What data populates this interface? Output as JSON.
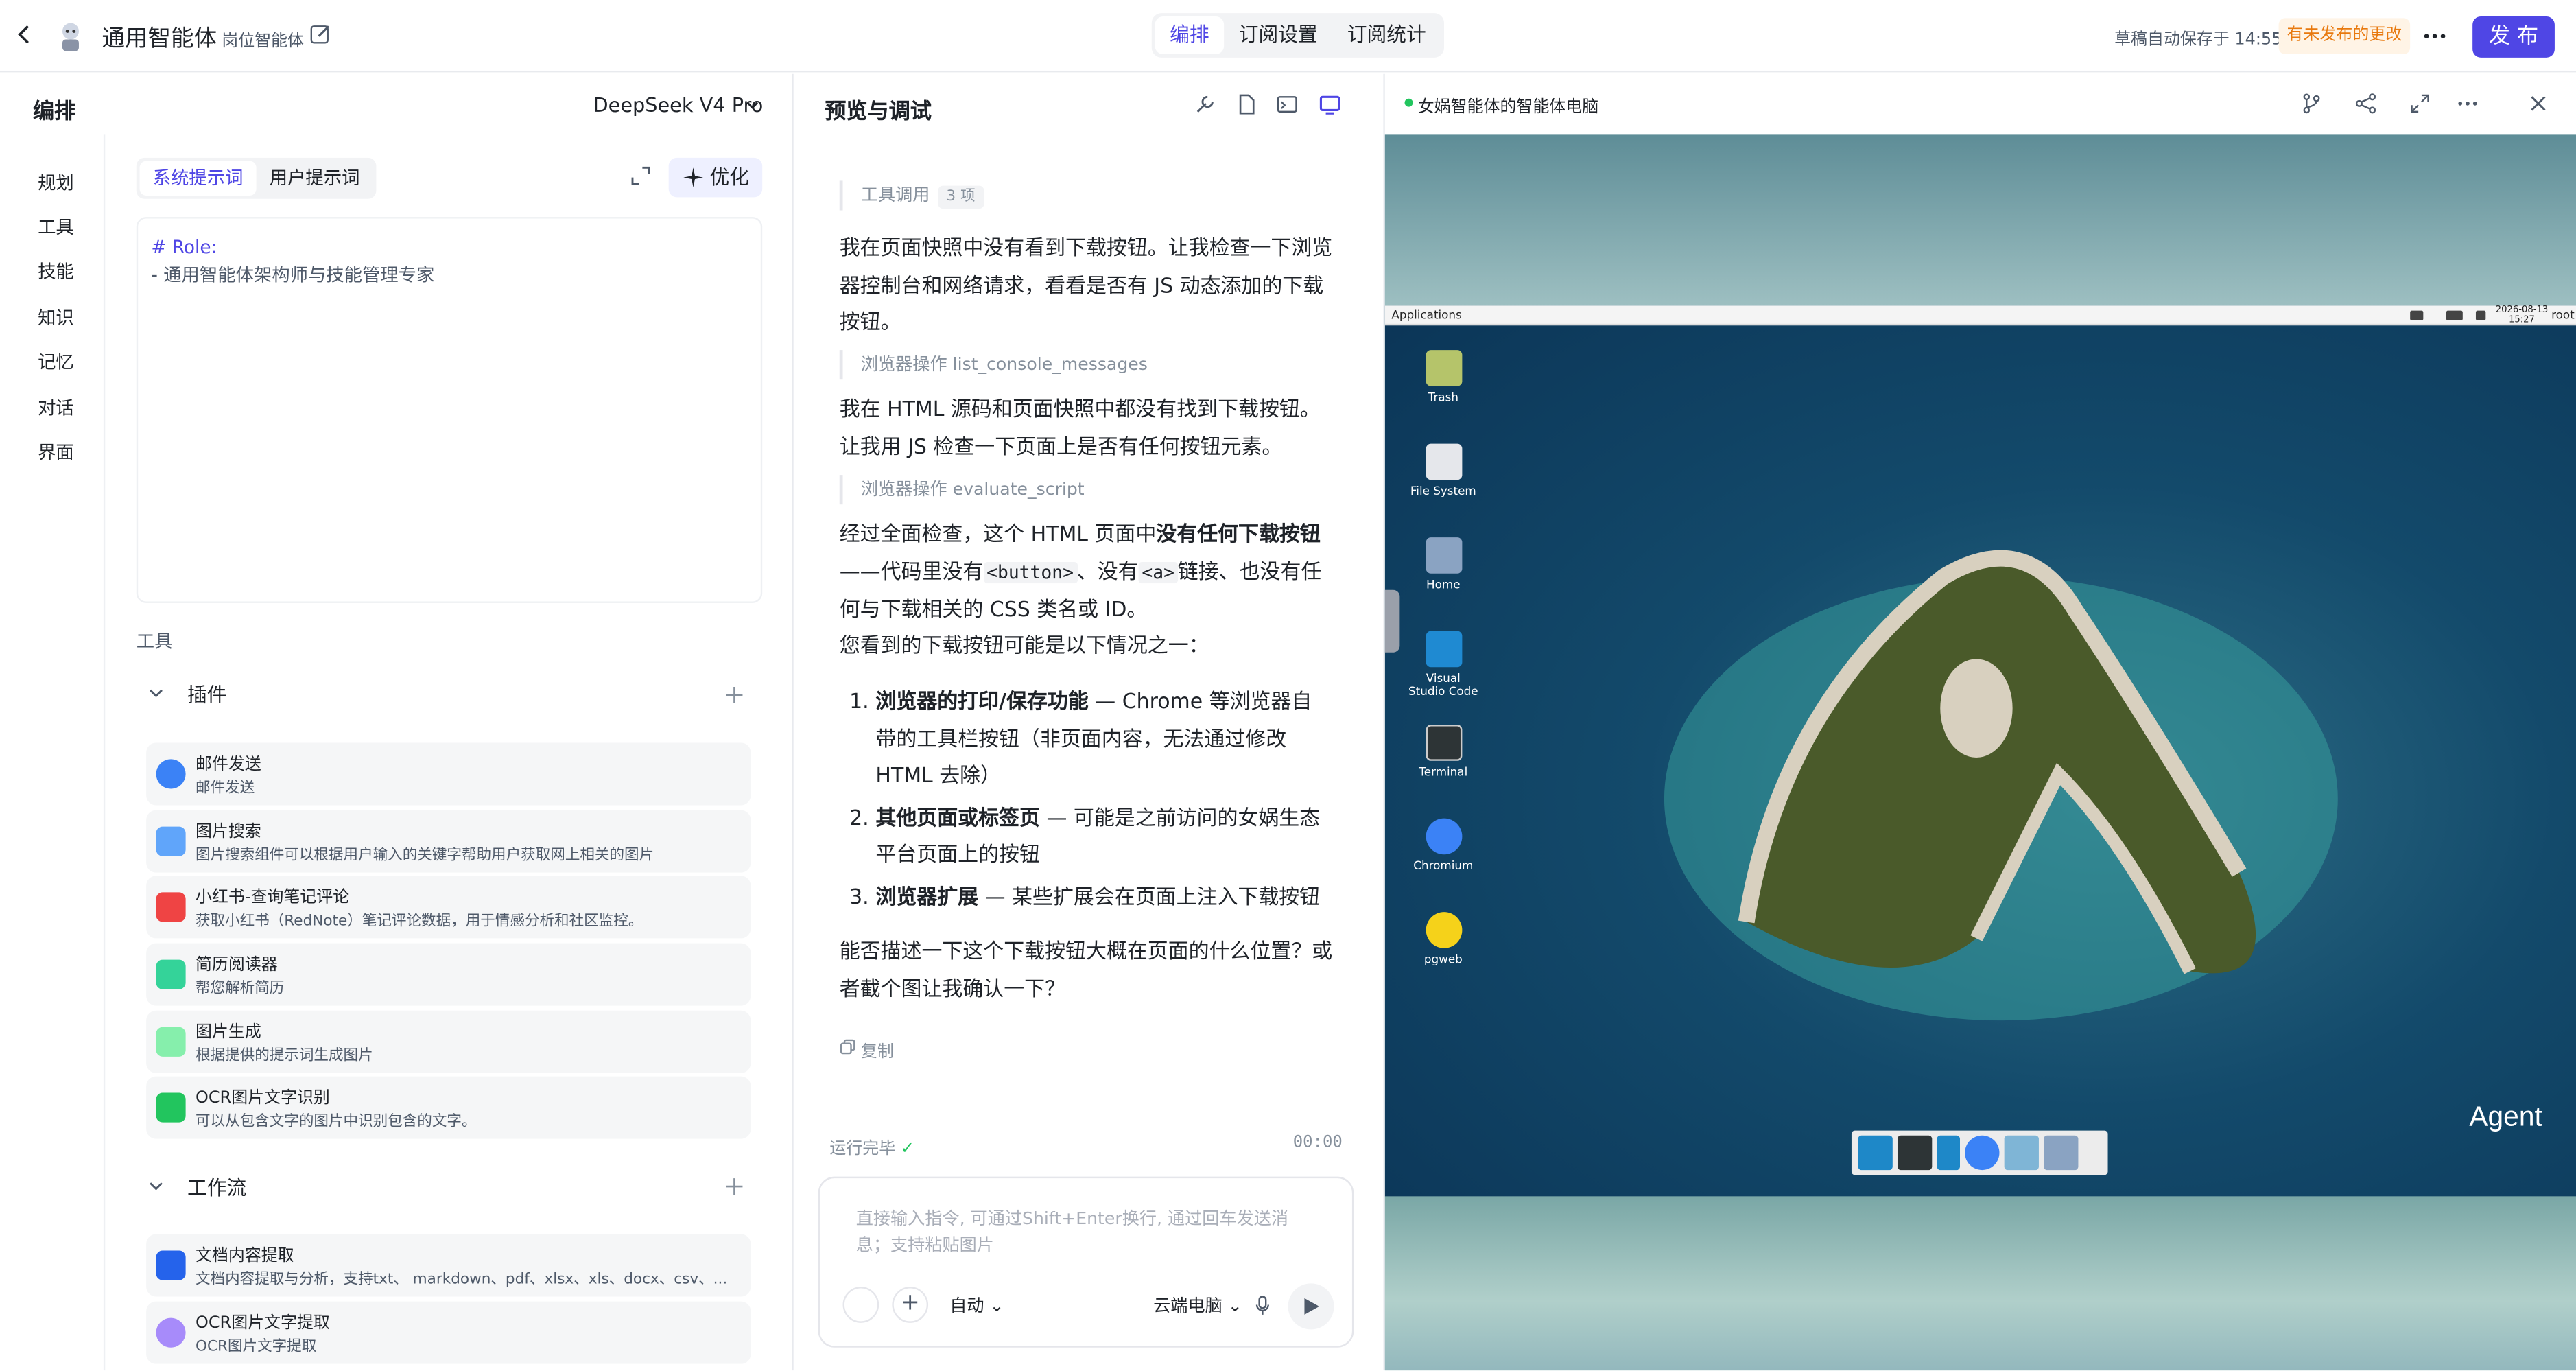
{
  "header": {
    "agent_name": "通用智能体",
    "role_label": "岗位智能体",
    "tabs": [
      "编排",
      "订阅设置",
      "订阅统计"
    ],
    "saved_text": "草稿自动保存于 14:55",
    "unpublished": "有未发布的更改",
    "publish": "发 布"
  },
  "left": {
    "title": "编排",
    "model": "DeepSeek V4 Pro",
    "nav": [
      "规划",
      "工具",
      "技能",
      "知识",
      "记忆",
      "对话",
      "界面"
    ],
    "prompt_tabs": [
      "系统提示词",
      "用户提示词"
    ],
    "optimize": "优化",
    "prompt_line1": "# Role:",
    "prompt_line2": "- 通用智能体架构师与技能管理专家",
    "tools_label": "工具",
    "plugins_label": "插件",
    "plugins": [
      {
        "title": "邮件发送",
        "desc": "邮件发送",
        "color": "#3b82f6"
      },
      {
        "title": "图片搜索",
        "desc": "图片搜索组件可以根据用户输入的关键字帮助用户获取网上相关的图片",
        "color": "#60a5fa"
      },
      {
        "title": "小红书-查询笔记评论",
        "desc": "获取小红书（RedNote）笔记评论数据，用于情感分析和社区监控。",
        "color": "#ef4444"
      },
      {
        "title": "简历阅读器",
        "desc": "帮您解析简历",
        "color": "#34d399"
      },
      {
        "title": "图片生成",
        "desc": "根据提供的提示词生成图片",
        "color": "#86efac"
      },
      {
        "title": "OCR图片文字识别",
        "desc": "可以从包含文字的图片中识别包含的文字。",
        "color": "#22c55e"
      }
    ],
    "workflow_label": "工作流",
    "workflows": [
      {
        "title": "文档内容提取",
        "desc": "文档内容提取与分析，支持txt、 markdown、pdf、xlsx、xls、docx、csv、...",
        "color": "#2563eb"
      },
      {
        "title": "OCR图片文字提取",
        "desc": "OCR图片文字提取",
        "color": "#a78bfa"
      }
    ]
  },
  "mid": {
    "title": "预览与调试",
    "tool_call": "工具调用",
    "tool_count": "3 项",
    "p1": "我在页面快照中没有看到下载按钮。让我检查一下浏览器控制台和网络请求，看看是否有 JS 动态添加的下载按钮。",
    "step1": "浏览器操作 list_console_messages",
    "p2": "我在 HTML 源码和页面快照中都没有找到下载按钮。让我用 JS 检查一下页面上是否有任何按钮元素。",
    "step2": "浏览器操作 evaluate_script",
    "p3a": "经过全面检查，这个 HTML 页面中",
    "p3b": "没有任何下载按钮",
    "p3c": "——代码里没有",
    "p3code1": "<button>",
    "p3d": "、没有",
    "p3code2": "<a>",
    "p3e": "链接、也没有任何与下载相关的 CSS 类名或 ID。",
    "p4": "您看到的下载按钮可能是以下情况之一：",
    "li1b": "浏览器的打印/保存功能",
    "li1": " — Chrome 等浏览器自带的工具栏按钮（非页面内容，无法通过修改 HTML 去除）",
    "li2b": "其他页面或标签页",
    "li2": " — 可能是之前访问的女娲生态平台页面上的按钮",
    "li3b": "浏览器扩展",
    "li3": " — 某些扩展会在页面上注入下载按钮",
    "p5": "能否描述一下这个下载按钮大概在页面的什么位置？或者截个图让我确认一下？",
    "copy": "复制",
    "status": "运行完毕",
    "timer": "00:00",
    "placeholder": "直接输入指令, 可通过Shift+Enter换行, 通过回车发送消息；支持粘贴图片",
    "mode": "自动",
    "target": "云端电脑"
  },
  "right": {
    "title": "女娲智能体的智能体电脑",
    "desktop": {
      "apps_menu": "Applications",
      "date": "2026-08-13",
      "time": "15:27",
      "user": "root",
      "icons": [
        {
          "label": "Trash"
        },
        {
          "label": "File System"
        },
        {
          "label": "Home"
        },
        {
          "label": "Visual Studio Code"
        },
        {
          "label": "Terminal"
        },
        {
          "label": "Chromium"
        },
        {
          "label": "pgweb"
        }
      ],
      "watermark": "Agent"
    }
  }
}
